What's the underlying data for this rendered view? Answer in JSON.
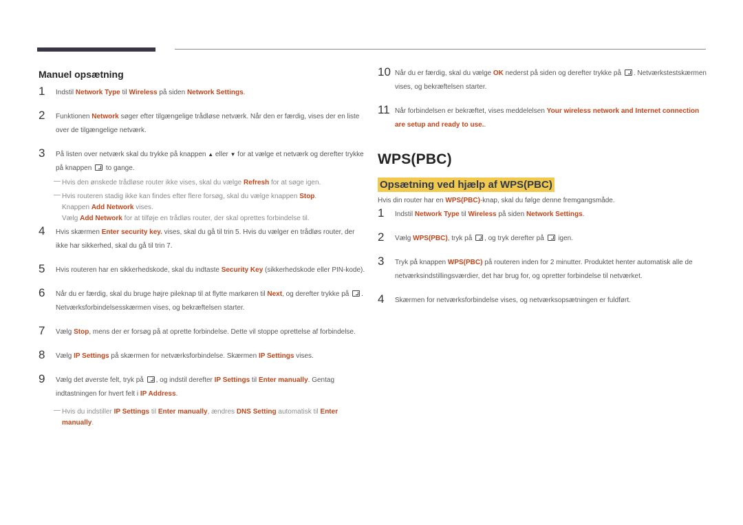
{
  "left": {
    "heading": "Manuel opsætning",
    "steps": [
      {
        "num": "1",
        "parts": [
          [
            "Indstil ",
            0
          ],
          [
            "Network Type",
            1
          ],
          [
            " til ",
            0
          ],
          [
            "Wireless",
            1
          ],
          [
            " på siden ",
            0
          ],
          [
            "Network Settings",
            1
          ],
          [
            ".",
            0
          ]
        ]
      },
      {
        "num": "2",
        "parts": [
          [
            "Funktionen ",
            0
          ],
          [
            "Network",
            1
          ],
          [
            " søger efter tilgængelige trådløse netværk. Når den er færdig, vises der en liste over de tilgængelige netværk.",
            0
          ]
        ]
      },
      {
        "num": "3",
        "parts": [
          [
            "På listen over netværk skal du trykke på knappen ",
            0
          ],
          [
            "▲",
            "tri"
          ],
          [
            " eller ",
            0
          ],
          [
            "▼",
            "tri"
          ],
          [
            " for at vælge et netværk og derefter trykke på knappen ",
            0
          ],
          [
            "",
            "enter"
          ],
          [
            " to gange.",
            0
          ]
        ]
      }
    ],
    "notes_step3": [
      {
        "parts": [
          [
            "Hvis den ønskede trådløse router ikke vises, skal du vælge ",
            0
          ],
          [
            "Refresh",
            1
          ],
          [
            " for at søge igen.",
            0
          ]
        ]
      },
      {
        "parts": [
          [
            "Hvis routeren stadig ikke kan findes efter flere forsøg, skal du vælge knappen ",
            0
          ],
          [
            "Stop",
            1
          ],
          [
            ".",
            0
          ]
        ],
        "cont": [
          [
            [
              "Knappen ",
              0
            ],
            [
              "Add Network",
              1
            ],
            [
              " vises.",
              0
            ]
          ],
          [
            [
              "Vælg ",
              0
            ],
            [
              "Add Network",
              1
            ],
            [
              " for at tilføje en trådløs router, der skal oprettes forbindelse til.",
              0
            ]
          ]
        ]
      }
    ],
    "steps2": [
      {
        "num": "4",
        "parts": [
          [
            "Hvis skærmen ",
            0
          ],
          [
            "Enter security key.",
            1
          ],
          [
            " vises, skal du gå til trin 5. Hvis du vælger en trådløs router, der ikke har sikkerhed, skal du gå til trin 7.",
            0
          ]
        ]
      },
      {
        "num": "5",
        "parts": [
          [
            "Hvis routeren har en sikkerhedskode, skal du indtaste ",
            0
          ],
          [
            "Security Key",
            1
          ],
          [
            " (sikkerhedskode eller PIN-kode).",
            0
          ]
        ]
      },
      {
        "num": "6",
        "parts": [
          [
            "Når du er færdig, skal du bruge højre pileknap til at flytte markøren til ",
            0
          ],
          [
            "Next",
            1
          ],
          [
            ", og derefter trykke på ",
            0
          ],
          [
            "",
            "enter"
          ],
          [
            ". Netværksforbindelsesskærmen vises, og bekræftelsen starter.",
            0
          ]
        ]
      },
      {
        "num": "7",
        "parts": [
          [
            "Vælg ",
            0
          ],
          [
            "Stop",
            1
          ],
          [
            ", mens der er forsøg på at oprette forbindelse. Dette vil stoppe oprettelse af forbindelse.",
            0
          ]
        ]
      },
      {
        "num": "8",
        "parts": [
          [
            "Vælg ",
            0
          ],
          [
            "IP Settings",
            1
          ],
          [
            " på skærmen for netværksforbindelse. Skærmen ",
            0
          ],
          [
            "IP Settings",
            1
          ],
          [
            " vises.",
            0
          ]
        ]
      },
      {
        "num": "9",
        "parts": [
          [
            "Vælg det øverste felt, tryk på ",
            0
          ],
          [
            "",
            "enter"
          ],
          [
            ", og indstil derefter ",
            0
          ],
          [
            "IP Settings",
            1
          ],
          [
            " til ",
            0
          ],
          [
            "Enter manually",
            1
          ],
          [
            ". Gentag indtastningen for hvert felt i ",
            0
          ],
          [
            "IP Address",
            1
          ],
          [
            ".",
            0
          ]
        ]
      }
    ],
    "note_step9": {
      "parts": [
        [
          "Hvis du indstiller ",
          0
        ],
        [
          "IP Settings",
          1
        ],
        [
          " til ",
          0
        ],
        [
          "Enter manually",
          1
        ],
        [
          ", ændres ",
          0
        ],
        [
          "DNS Setting",
          1
        ],
        [
          " automatisk til ",
          0
        ],
        [
          "Enter manually",
          1
        ],
        [
          ".",
          0
        ]
      ]
    }
  },
  "right": {
    "steps": [
      {
        "num": "10",
        "parts": [
          [
            "Når du er færdig, skal du vælge ",
            0
          ],
          [
            "OK",
            1
          ],
          [
            " nederst på siden og derefter trykke på ",
            0
          ],
          [
            "",
            "enter"
          ],
          [
            ". Netværkstestskærmen vises, og bekræftelsen starter.",
            0
          ]
        ]
      },
      {
        "num": "11",
        "parts": [
          [
            "Når forbindelsen er bekræftet, vises meddelelsen ",
            0
          ],
          [
            "Your wireless network and Internet connection are setup and ready to use.",
            1
          ],
          [
            ".",
            0
          ]
        ]
      }
    ],
    "title": "WPS(PBC)",
    "subtitle": "Opsætning ved hjælp af WPS(PBC)",
    "intro": [
      [
        "Hvis din router har en ",
        0
      ],
      [
        "WPS(PBC)",
        1
      ],
      [
        "-knap, skal du følge denne fremgangsmåde.",
        0
      ]
    ],
    "wps_steps": [
      {
        "num": "1",
        "parts": [
          [
            "Indstil ",
            0
          ],
          [
            "Network Type",
            1
          ],
          [
            " til ",
            0
          ],
          [
            "Wireless",
            1
          ],
          [
            " på siden ",
            0
          ],
          [
            "Network Settings",
            1
          ],
          [
            ".",
            0
          ]
        ]
      },
      {
        "num": "2",
        "parts": [
          [
            "Vælg ",
            0
          ],
          [
            "WPS(PBC)",
            1
          ],
          [
            ", tryk på ",
            0
          ],
          [
            "",
            "enter"
          ],
          [
            ", og tryk derefter på ",
            0
          ],
          [
            "",
            "enter"
          ],
          [
            " igen.",
            0
          ]
        ]
      },
      {
        "num": "3",
        "parts": [
          [
            "Tryk på knappen ",
            0
          ],
          [
            "WPS(PBC)",
            1
          ],
          [
            " på routeren inden for 2 minutter. Produktet henter automatisk alle de netværksindstillingsværdier, det har brug for, og opretter forbindelse til netværket.",
            0
          ]
        ]
      },
      {
        "num": "4",
        "parts": [
          [
            "Skærmen for netværksforbindelse vises, og netværksopsætningen er fuldført.",
            0
          ]
        ]
      }
    ]
  },
  "colors": {
    "highlight": "#c0451b",
    "subtitle_bg": "#f1c94c",
    "subtitle_text": "#2f3752",
    "bar": "#3a3544"
  }
}
